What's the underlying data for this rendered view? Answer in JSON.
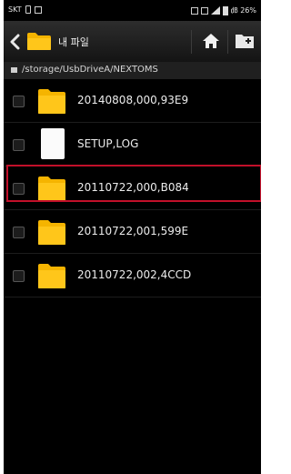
{
  "status_bar": {
    "carrier": "SKT",
    "right_text": "㏈ 26%"
  },
  "action_bar": {
    "title": "내 파일",
    "icons": [
      "back-chevron-icon",
      "folder-icon",
      "home-icon",
      "new-folder-icon"
    ]
  },
  "path_bar": {
    "path": "/storage/UsbDriveA/NEXTOMS"
  },
  "files": [
    {
      "name": "20140808,000,93E9",
      "type": "folder",
      "icon": "folder-icon",
      "selected": false
    },
    {
      "name": "SETUP,LOG",
      "type": "file",
      "icon": "document-icon",
      "selected": false
    },
    {
      "name": "20110722,000,B084",
      "type": "folder",
      "icon": "folder-icon",
      "selected": false,
      "highlighted": true
    },
    {
      "name": "20110722,001,599E",
      "type": "folder",
      "icon": "folder-icon",
      "selected": false
    },
    {
      "name": "20110722,002,4CCD",
      "type": "folder",
      "icon": "folder-icon",
      "selected": false
    }
  ],
  "colors": {
    "background": "#000000",
    "folder": "#f5b400",
    "highlight_border": "#c2102a"
  }
}
